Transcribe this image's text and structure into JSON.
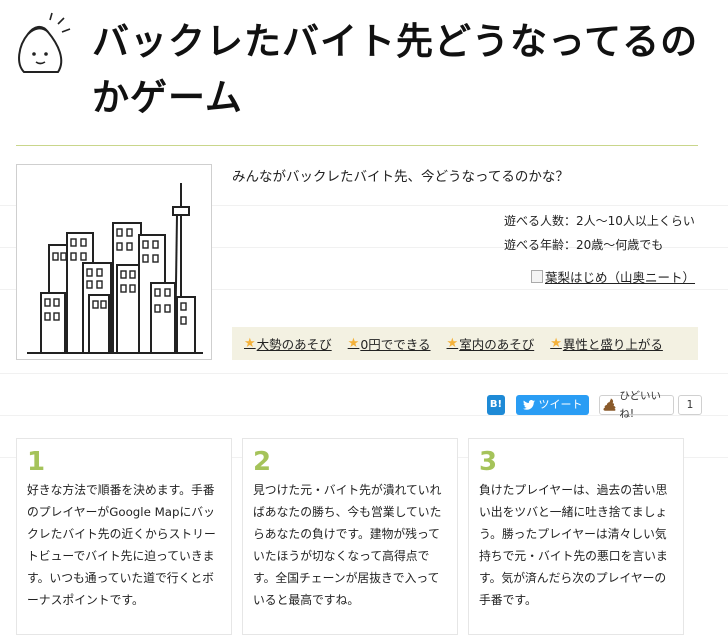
{
  "title": "バックレたバイト先どうなってるのかゲーム",
  "description": "みんながバックレたバイト先、今どうなってるのかな？",
  "meta": {
    "players": "遊べる人数：2人〜10人以上くらい",
    "ages": "遊べる年齢：20歳〜何歳でも"
  },
  "author": "葉梨はじめ（山奥ニート）",
  "tags": [
    {
      "label": "大勢のあそび",
      "icon": "star-icon"
    },
    {
      "label": "0円でできる",
      "icon": "star-icon"
    },
    {
      "label": "室内のあそび",
      "icon": "star-icon"
    },
    {
      "label": "異性と盛り上がる",
      "icon": "star-icon"
    }
  ],
  "share": {
    "hatena_label": "B!",
    "tweet_label": "ツイート",
    "hidoi_label": "ひどいいね!",
    "hidoi_count": "1"
  },
  "steps": [
    {
      "num": "1",
      "text": "好きな方法で順番を決めます。手番のプレイヤーがGoogle Mapにバックレたバイト先の近くからストリートビューでバイト先に迫っていきます。いつも通っていた道で行くとボーナスポイントです。"
    },
    {
      "num": "2",
      "text": "見つけた元・バイト先が潰れていればあなたの勝ち、今も営業していたらあなたの負けです。建物が残っていたほうが切なくなって高得点です。全国チェーンが居抜きで入っていると最高ですね。"
    },
    {
      "num": "3",
      "text": "負けたプレイヤーは、過去の苦い思い出をツバと一緒に吐き捨てましょう。勝ったプレイヤーは清々しい気持ちで元・バイト先の悪口を言います。気が済んだら次のプレイヤーの手番です。"
    }
  ],
  "colors": {
    "accent_green": "#a5c35a",
    "tag_bg": "#f3f1e2",
    "star": "#f4b23c",
    "hatena_blue": "#1e8ad6",
    "twitter_blue": "#2a9df4"
  }
}
